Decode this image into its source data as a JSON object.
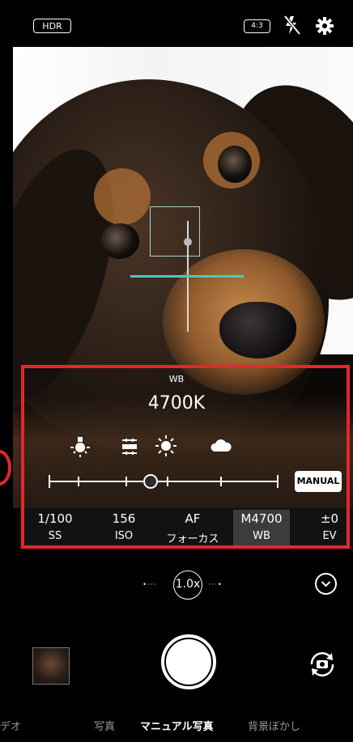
{
  "top_bar": {
    "hdr_label": "HDR",
    "aspect_ratio_label": "4:3",
    "icons": [
      "flash-off-icon",
      "gear-icon"
    ]
  },
  "white_balance": {
    "label": "WB",
    "value": "4700K",
    "presets": [
      "incandescent-icon",
      "fluorescent-icon",
      "daylight-icon",
      "cloudy-icon"
    ],
    "slider_position_pct": 44,
    "manual_label": "MANUAL"
  },
  "settings": [
    {
      "value": "1/100",
      "name": "SS"
    },
    {
      "value": "156",
      "name": "ISO"
    },
    {
      "value": "AF",
      "name": "フォーカス"
    },
    {
      "value": "M4700",
      "name": "WB",
      "active": true
    },
    {
      "value": "±0",
      "name": "EV"
    }
  ],
  "zoom": {
    "label": "1.0x"
  },
  "modes": [
    "デオ",
    "写真",
    "マニュアル写真",
    "背景ぼかし"
  ],
  "active_mode": "マニュアル写真",
  "colors": {
    "highlight_red": "#e4272b",
    "wb_line": "#4fc7c0",
    "active_tab_bg": "#3c3c3c"
  }
}
